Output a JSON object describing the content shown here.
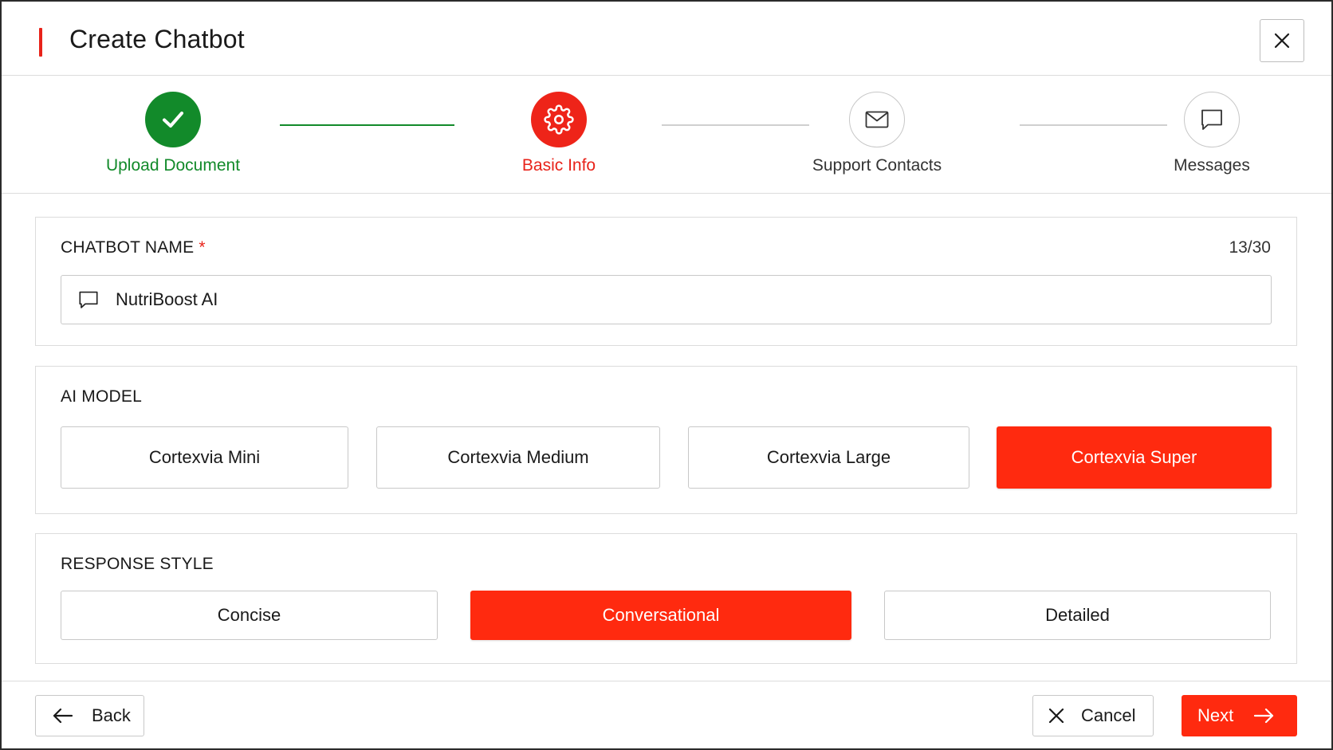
{
  "header": {
    "title": "Create Chatbot",
    "close_icon": "close-icon"
  },
  "colors": {
    "accent": "#ff2a0f",
    "success": "#128a2a",
    "border": "#c8c8c8"
  },
  "stepper": {
    "steps": [
      {
        "label": "Upload Document",
        "state": "done",
        "icon": "check-icon"
      },
      {
        "label": "Basic Info",
        "state": "active",
        "icon": "gear-icon"
      },
      {
        "label": "Support Contacts",
        "state": "todo",
        "icon": "mail-icon"
      },
      {
        "label": "Messages",
        "state": "todo",
        "icon": "chat-bubble-icon"
      }
    ]
  },
  "chatbot_name": {
    "label": "CHATBOT NAME",
    "required_mark": "*",
    "counter": "13/30",
    "value": "NutriBoost AI",
    "icon": "chat-bubble-icon"
  },
  "ai_model": {
    "label": "AI MODEL",
    "options": [
      "Cortexvia Mini",
      "Cortexvia Medium",
      "Cortexvia Large",
      "Cortexvia Super"
    ],
    "selected": "Cortexvia Super"
  },
  "response_style": {
    "label": "RESPONSE STYLE",
    "options": [
      "Concise",
      "Conversational",
      "Detailed"
    ],
    "selected": "Conversational"
  },
  "footer": {
    "back_label": "Back",
    "cancel_label": "Cancel",
    "next_label": "Next"
  }
}
